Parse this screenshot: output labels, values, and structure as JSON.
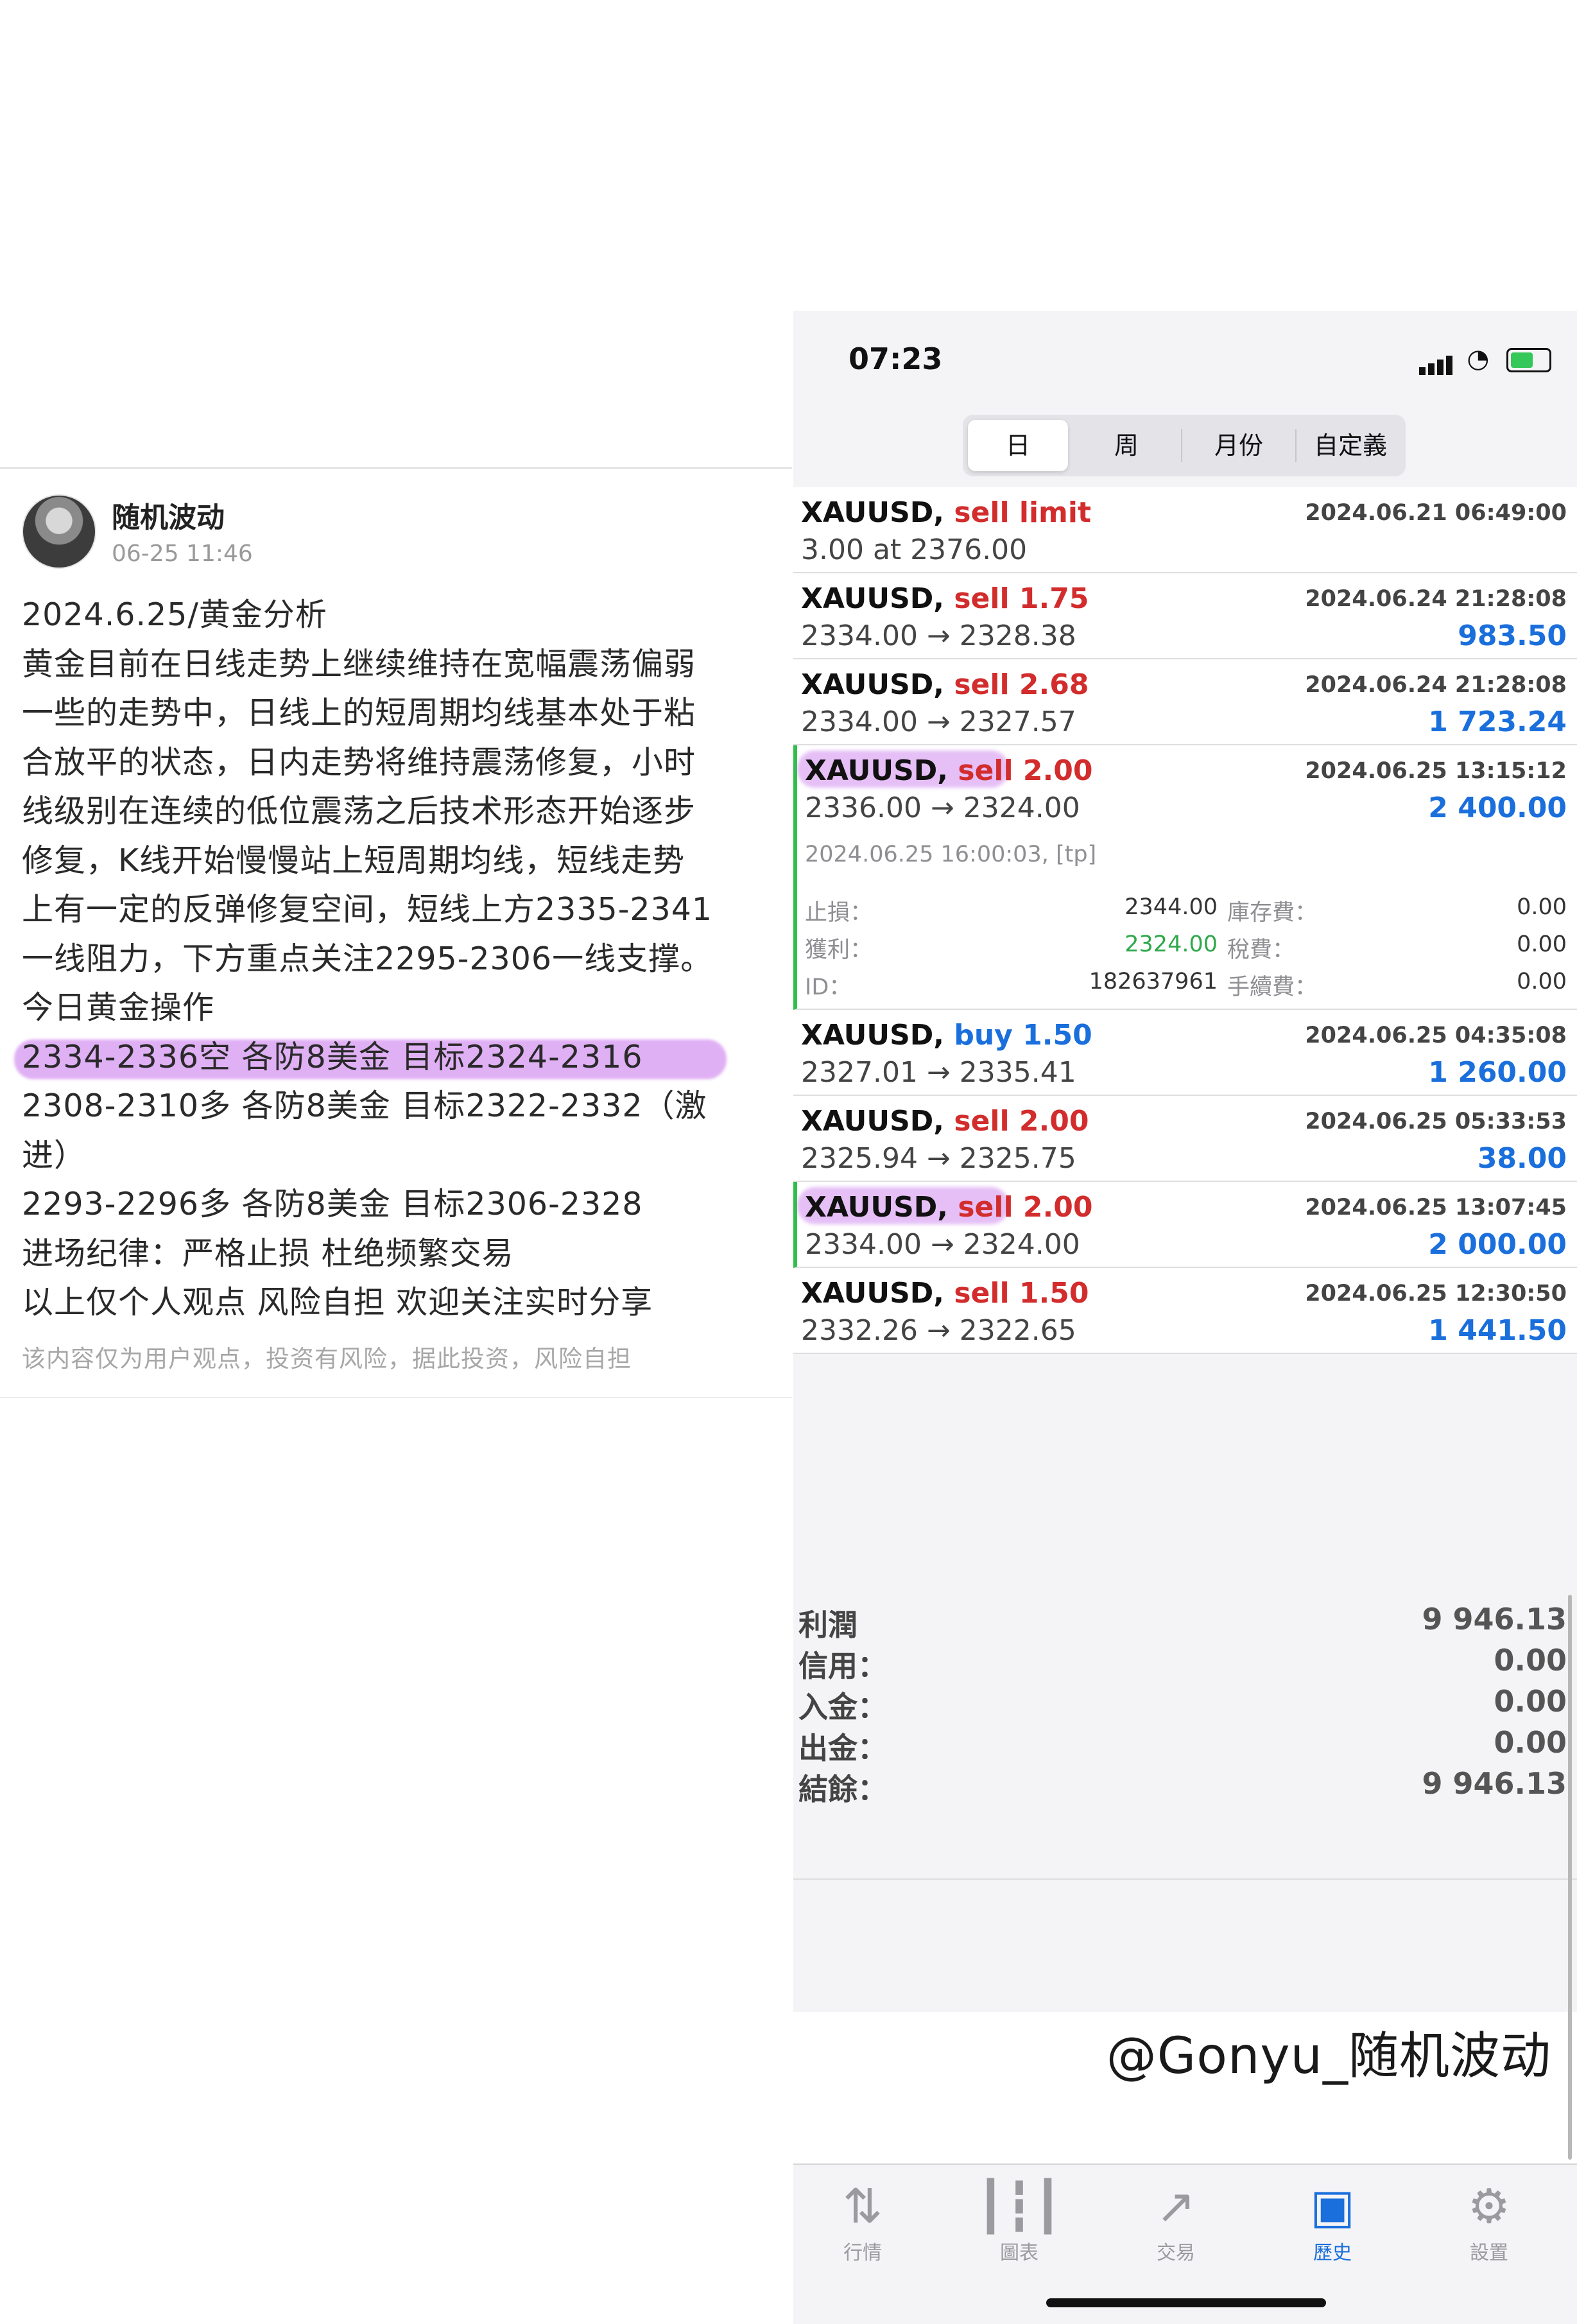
{
  "post": {
    "author": "随机波动",
    "time": "06-25 11:46",
    "lines": [
      "2024.6.25/黄金分析",
      "黄金目前在日线走势上继续维持在宽幅震荡偏弱",
      "一些的走势中，日线上的短周期均线基本处于粘",
      "合放平的状态，日内走势将维持震荡修复，小时",
      "线级别在连续的低位震荡之后技术形态开始逐步",
      "修复，K线开始慢慢站上短周期均线，短线走势",
      "上有一定的反弹修复空间，短线上方2335-2341",
      "一线阻力，下方重点关注2295-2306一线支撑。",
      "今日黄金操作",
      "2334-2336空 各防8美金 目标2324-2316",
      "2308-2310多 各防8美金 目标2322-2332（激",
      "进）",
      "2293-2296多 各防8美金 目标2306-2328",
      "进场纪律：严格止损 杜绝频繁交易",
      "以上仅个人观点 风险自担 欢迎关注实时分享"
    ],
    "disclaimer": "该内容仅为用户观点，投资有风险，据此投资，风险自担"
  },
  "phone": {
    "status_time": "07:23",
    "tabs": [
      "日",
      "周",
      "月份",
      "自定義"
    ],
    "orders": [
      {
        "symbol": "XAUUSD,",
        "side": "sell limit",
        "volume": "",
        "date": "2024.06.21 06:49:00",
        "price": "3.00 at 2376.00",
        "profit": ""
      },
      {
        "symbol": "XAUUSD,",
        "side": "sell",
        "volume": "1.75",
        "date": "2024.06.24 21:28:08",
        "price": "2334.00 → 2328.38",
        "profit": "983.50"
      },
      {
        "symbol": "XAUUSD,",
        "side": "sell",
        "volume": "2.68",
        "date": "2024.06.24 21:28:08",
        "price": "2334.00 → 2327.57",
        "profit": "1 723.24"
      },
      {
        "symbol": "XAUUSD,",
        "side": "sell",
        "volume": "2.00",
        "date": "2024.06.25 13:15:12",
        "price": "2336.00 → 2324.00",
        "profit": "2 400.00"
      },
      {
        "symbol": "XAUUSD,",
        "side": "buy",
        "volume": "1.50",
        "date": "2024.06.25 04:35:08",
        "price": "2327.01 → 2335.41",
        "profit": "1 260.00"
      },
      {
        "symbol": "XAUUSD,",
        "side": "sell",
        "volume": "2.00",
        "date": "2024.06.25 05:33:53",
        "price": "2325.94 → 2325.75",
        "profit": "38.00"
      },
      {
        "symbol": "XAUUSD,",
        "side": "sell",
        "volume": "2.00",
        "date": "2024.06.25 13:07:45",
        "price": "2334.00 → 2324.00",
        "profit": "2 000.00"
      },
      {
        "symbol": "XAUUSD,",
        "side": "sell",
        "volume": "1.50",
        "date": "2024.06.25 12:30:50",
        "price": "2332.26 → 2322.65",
        "profit": "1 441.50"
      }
    ],
    "detail": {
      "close_time": "2024.06.25 16:00:03, [tp]",
      "sl_label": "止損：",
      "sl_value": "2344.00",
      "tp_label": "獲利：",
      "tp_value": "2324.00",
      "id_label": "ID：",
      "id_value": "182637961",
      "swap_label": "庫存費：",
      "swap_value": "0.00",
      "tax_label": "稅費：",
      "tax_value": "0.00",
      "fee_label": "手續費：",
      "fee_value": "0.00"
    },
    "summary": [
      {
        "label": "利潤",
        "value": "9 946.13"
      },
      {
        "label": "信用：",
        "value": "0.00"
      },
      {
        "label": "入金：",
        "value": "0.00"
      },
      {
        "label": "出金：",
        "value": "0.00"
      },
      {
        "label": "結餘：",
        "value": "9 946.13"
      }
    ],
    "tabbar": [
      {
        "label": "行情",
        "icon": "quotes-arrows-icon"
      },
      {
        "label": "圖表",
        "icon": "candlestick-chart-icon"
      },
      {
        "label": "交易",
        "icon": "trade-trend-icon"
      },
      {
        "label": "歷史",
        "icon": "history-inbox-icon"
      },
      {
        "label": "設置",
        "icon": "gear-icon"
      }
    ]
  },
  "watermark": "@Gonyu_随机波动",
  "colors": {
    "sell": "#d22c2c",
    "buy": "#1a6fdc",
    "profit": "#1a6fdc",
    "highlight": "#c670ec",
    "active_marker": "#2fbf4a"
  }
}
